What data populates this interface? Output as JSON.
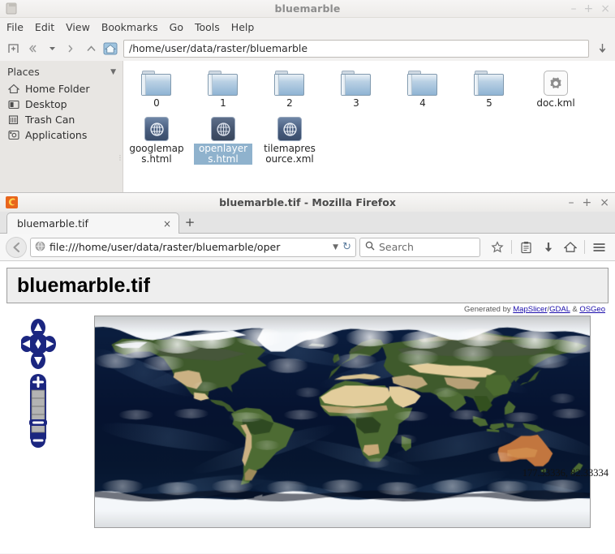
{
  "filemanager": {
    "title": "bluemarble",
    "window_buttons": {
      "minimize": "–",
      "maximize": "+",
      "close": "×"
    },
    "menu": [
      "File",
      "Edit",
      "View",
      "Bookmarks",
      "Go",
      "Tools",
      "Help"
    ],
    "toolbar": {
      "new_tab_icon": "new-tab-icon",
      "back_icon": "back-icon",
      "history_dropdown_icon": "chevron-down-icon",
      "forward_icon": "forward-icon",
      "up_icon": "chevron-up-icon",
      "home_icon": "home-icon",
      "path": "/home/user/data/raster/bluemarble",
      "download_icon": "download-icon"
    },
    "sidebar": {
      "heading": "Places",
      "items": [
        {
          "label": "Home Folder",
          "icon": "home-icon"
        },
        {
          "label": "Desktop",
          "icon": "desktop-icon"
        },
        {
          "label": "Trash Can",
          "icon": "trash-icon"
        },
        {
          "label": "Applications",
          "icon": "applications-icon"
        }
      ]
    },
    "files": [
      {
        "name": "0",
        "type": "folder",
        "selected": false
      },
      {
        "name": "1",
        "type": "folder",
        "selected": false
      },
      {
        "name": "2",
        "type": "folder",
        "selected": false
      },
      {
        "name": "3",
        "type": "folder",
        "selected": false
      },
      {
        "name": "4",
        "type": "folder",
        "selected": false
      },
      {
        "name": "5",
        "type": "folder",
        "selected": false
      },
      {
        "name": "doc.kml",
        "type": "kml",
        "selected": false
      },
      {
        "name": "googlemaps.html",
        "type": "html",
        "selected": false
      },
      {
        "name": "openlayers.html",
        "type": "html",
        "selected": true
      },
      {
        "name": "tilemapresource.xml",
        "type": "html",
        "selected": false
      }
    ]
  },
  "firefox": {
    "title": "bluemarble.tif - Mozilla Firefox",
    "window_buttons": {
      "minimize": "–",
      "maximize": "+",
      "close": "×"
    },
    "tab": {
      "label": "bluemarble.tif",
      "close_label": "×"
    },
    "new_tab_label": "+",
    "nav": {
      "back_icon": "back-arrow-icon",
      "site_icon": "globe-icon",
      "url": "file:///home/user/data/raster/bluemarble/oper",
      "url_dropdown_icon": "chevron-down-icon",
      "reload_icon": "reload-icon",
      "search_placeholder": "Search",
      "search_icon": "search-icon",
      "bookmark_icon": "star-icon",
      "reader_icon": "library-icon",
      "downloads_icon": "download-arrow-icon",
      "home_icon": "home-icon",
      "menu_icon": "hamburger-menu-icon"
    }
  },
  "page": {
    "heading": "bluemarble.tif",
    "credit": {
      "prefix": "Generated by ",
      "link1": "MapSlicer",
      "sep1": "/",
      "link2": "GDAL",
      "sep2": " & ",
      "link3": "OSGeo"
    },
    "map": {
      "pan_control": {
        "up_icon": "pan-up-icon",
        "down_icon": "pan-down-icon",
        "left_icon": "pan-left-icon",
        "right_icon": "pan-right-icon",
        "center_icon": "pan-center-icon"
      },
      "zoom_control": {
        "zoom_in_label": "+",
        "zoom_out_label": "–",
        "levels": 6,
        "current_level": 2
      },
      "coordinates": "177.33336, 82.33334",
      "layer": "NASA Blue Marble world imagery",
      "accent_color": "#1b2680"
    }
  }
}
